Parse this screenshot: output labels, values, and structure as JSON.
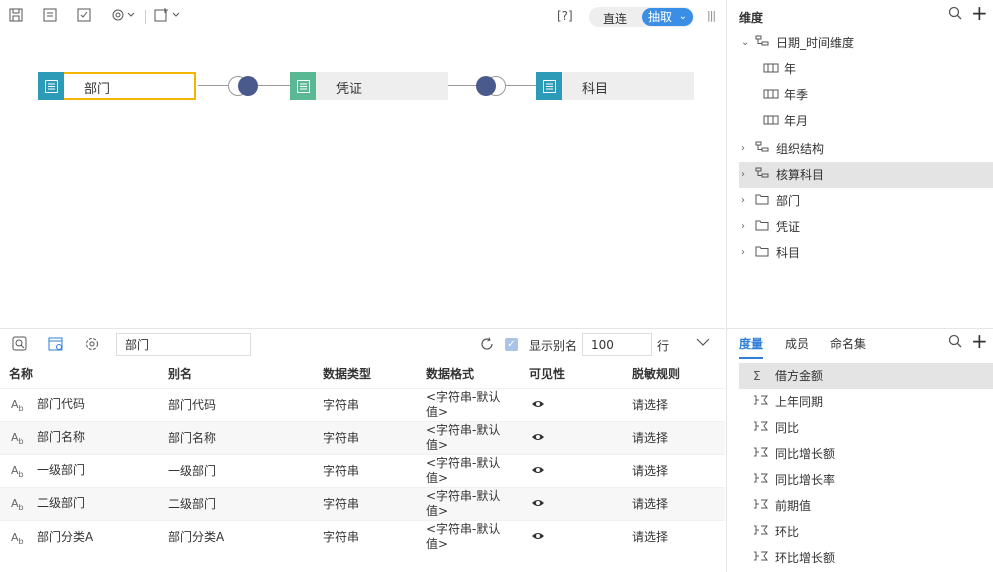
{
  "toolbar": {
    "help_label": "[?]",
    "mode_direct": "直连",
    "mode_extract": "抽取"
  },
  "canvas": {
    "nodes": [
      {
        "label": "部门",
        "color": "#2b9bb8"
      },
      {
        "label": "凭证",
        "color": "#5bb894"
      },
      {
        "label": "科目",
        "color": "#2b9bb8"
      }
    ]
  },
  "grid_toolbar": {
    "search_value": "部门",
    "show_alias_label": "显示别名",
    "limit_value": "100",
    "limit_unit": "行"
  },
  "table": {
    "headers": [
      "名称",
      "别名",
      "数据类型",
      "数据格式",
      "可见性",
      "脱敏规则"
    ],
    "rows": [
      {
        "name": "部门代码",
        "alias": "部门代码",
        "type": "字符串",
        "format_1": "<字符串-默认",
        "format_2": "值>",
        "mask": "请选择"
      },
      {
        "name": "部门名称",
        "alias": "部门名称",
        "type": "字符串",
        "format_1": "<字符串-默认",
        "format_2": "值>",
        "mask": "请选择"
      },
      {
        "name": "一级部门",
        "alias": "一级部门",
        "type": "字符串",
        "format_1": "<字符串-默认",
        "format_2": "值>",
        "mask": "请选择"
      },
      {
        "name": "二级部门",
        "alias": "二级部门",
        "type": "字符串",
        "format_1": "<字符串-默认",
        "format_2": "值>",
        "mask": "请选择"
      },
      {
        "name": "部门分类A",
        "alias": "部门分类A",
        "type": "字符串",
        "format_1": "<字符串-默认",
        "format_2": "值>",
        "mask": "请选择"
      }
    ]
  },
  "dimensions": {
    "title": "维度",
    "items": [
      {
        "label": "日期_时间维度",
        "arrow": "⌄"
      },
      {
        "label": "年"
      },
      {
        "label": "年季"
      },
      {
        "label": "年月"
      },
      {
        "label": "组织结构",
        "arrow": "›"
      },
      {
        "label": "核算科目",
        "arrow": "›"
      },
      {
        "label": "部门",
        "arrow": "›"
      },
      {
        "label": "凭证",
        "arrow": "›"
      },
      {
        "label": "科目",
        "arrow": "›"
      }
    ]
  },
  "measures": {
    "tabs": [
      "度量",
      "成员",
      "命名集"
    ],
    "items": [
      "借方金额",
      "上年同期",
      "同比",
      "同比增长额",
      "同比增长率",
      "前期值",
      "环比",
      "环比增长额"
    ]
  },
  "colors": {
    "accent": "#2f7fd8",
    "selected_border": "#f5b400",
    "join_dark": "#4a5a8c"
  }
}
